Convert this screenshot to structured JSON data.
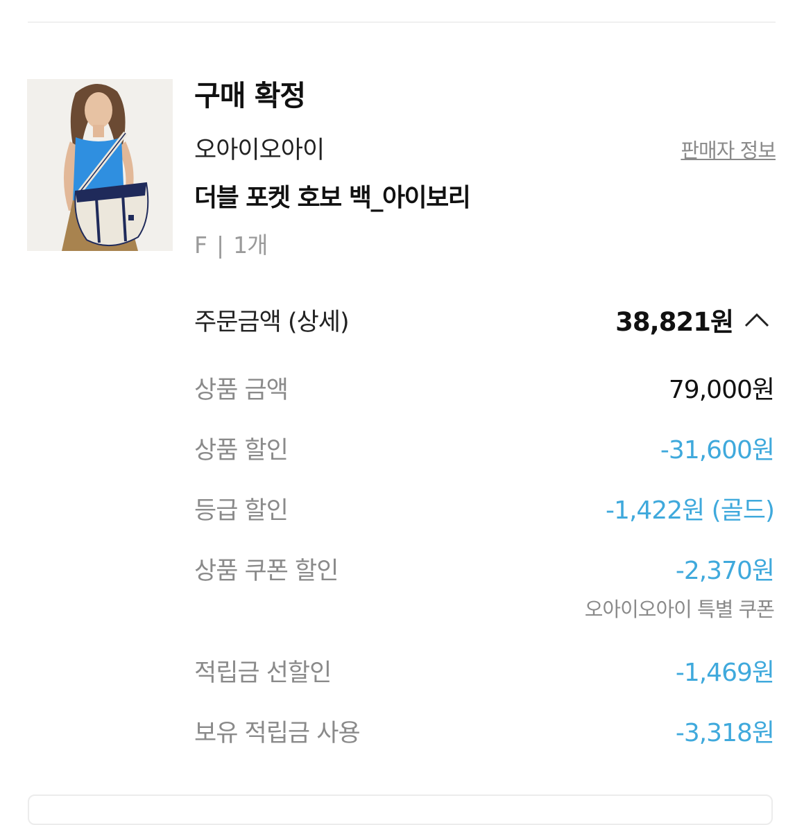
{
  "order": {
    "status": "구매 확정",
    "brand": "오아이오아이",
    "seller_info_link": "판매자 정보",
    "product_name": "더블 포켓 호보 백_아이보리",
    "option_size": "F",
    "option_separator": "|",
    "option_quantity": "1개"
  },
  "summary": {
    "label": "주문금액 (상세)",
    "total": "38,821원",
    "toggle_icon": "chevron-up-icon"
  },
  "details": [
    {
      "label": "상품 금액",
      "value": "79,000원",
      "color": "#111111"
    },
    {
      "label": "상품 할인",
      "value": "-31,600원",
      "color": "#3fa9dc"
    },
    {
      "label": "등급 할인",
      "value": "-1,422원 (골드)",
      "color": "#3fa9dc"
    },
    {
      "label": "상품 쿠폰 할인",
      "value": "-2,370원",
      "color": "#3fa9dc",
      "note": "오아이오아이 특별 쿠폰"
    },
    {
      "label": "적립금 선할인",
      "value": "-1,469원",
      "color": "#3fa9dc"
    },
    {
      "label": "보유 적립금 사용",
      "value": "-3,318원",
      "color": "#3fa9dc"
    }
  ],
  "colors": {
    "discount_blue": "#3fa9dc",
    "muted_gray": "#8a8a8a",
    "text_dark": "#111111"
  }
}
